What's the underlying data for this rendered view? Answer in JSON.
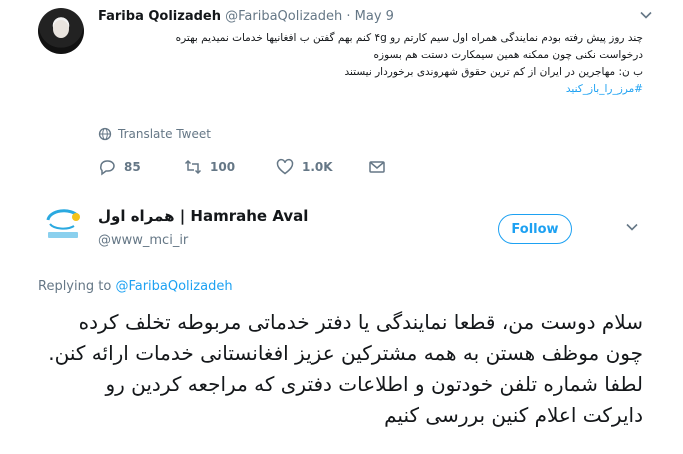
{
  "parent_tweet": {
    "author_name": "Fariba Qolizadeh",
    "author_handle": "@FaribaQolizadeh",
    "separator": "·",
    "date": "May 9",
    "text_lines": [
      "چند روز پیش رفته بودم نمایندگی همراه اول سیم کارتم رو ۴g کنم بهم گفتن ب افغانیها خدمات نمیدیم بهتره",
      "درخواست نکنی چون ممکنه همین سیمکارت دستت هم بسوزه",
      "ب ن: مهاجرین در ایران از کم ترین حقوق شهروندی برخوردار نیستند"
    ],
    "hashtag": "#مرز_را_باز_کنید",
    "translate_label": "Translate Tweet",
    "reply_count": "85",
    "retweet_count": "100",
    "like_count": "1.0K"
  },
  "reply_tweet": {
    "author_name": "همراه اول | Hamrahe Aval",
    "author_handle": "@www_mci_ir",
    "follow_label": "Follow",
    "replying_prefix": "Replying to",
    "replying_handle": "@FaribaQolizadeh",
    "text": "سلام دوست من، قطعا نمایندگی یا دفتر خدماتی مربوطه تخلف کرده چون موظف هستن به همه مشترکین عزیز افغانستانی خدمات ارائه کنن. لطفا شماره تلفن خودتون و اطلاعات دفتری که مراجعه کردین رو دایرکت اعلام کنین بررسی کنیم"
  },
  "colors": {
    "accent": "#1da1f2",
    "muted": "#657786",
    "text": "#14171a"
  }
}
